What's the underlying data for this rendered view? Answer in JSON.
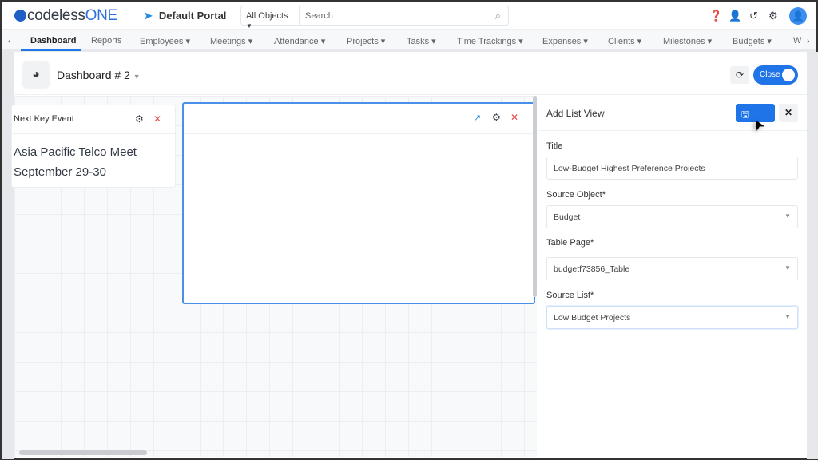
{
  "header": {
    "logo_prefix": "codeless",
    "logo_suffix": "ONE",
    "portal": "Default Portal",
    "object_select": "All Objects",
    "search_placeholder": "Search"
  },
  "nav": {
    "items": [
      "Dashboard",
      "Reports",
      "Employees",
      "Meetings",
      "Attendance",
      "Projects",
      "Tasks",
      "Time Trackings",
      "Expenses",
      "Clients",
      "Milestones",
      "Budgets",
      "W"
    ],
    "active": "Dashboard"
  },
  "dashboard": {
    "title": "Dashboard # 2",
    "close_label": "Close"
  },
  "widgets": [
    {
      "title": "Next Key Event",
      "line1": "Asia Pacific Telco Meet",
      "line2": "September 29-30"
    }
  ],
  "panel": {
    "title": "Add List View",
    "save_label": "Save",
    "fields": [
      {
        "label": "Title",
        "value": "Low-Budget Highest Preference Projects"
      },
      {
        "label": "Source Object*",
        "value": "Budget"
      },
      {
        "label": "Table Page*",
        "value": "budgetf73856_Table"
      },
      {
        "label": "Source List*",
        "value": "Low Budget Projects"
      }
    ]
  },
  "colors": {
    "accent": "#1f74e8",
    "danger": "#e5484d"
  }
}
